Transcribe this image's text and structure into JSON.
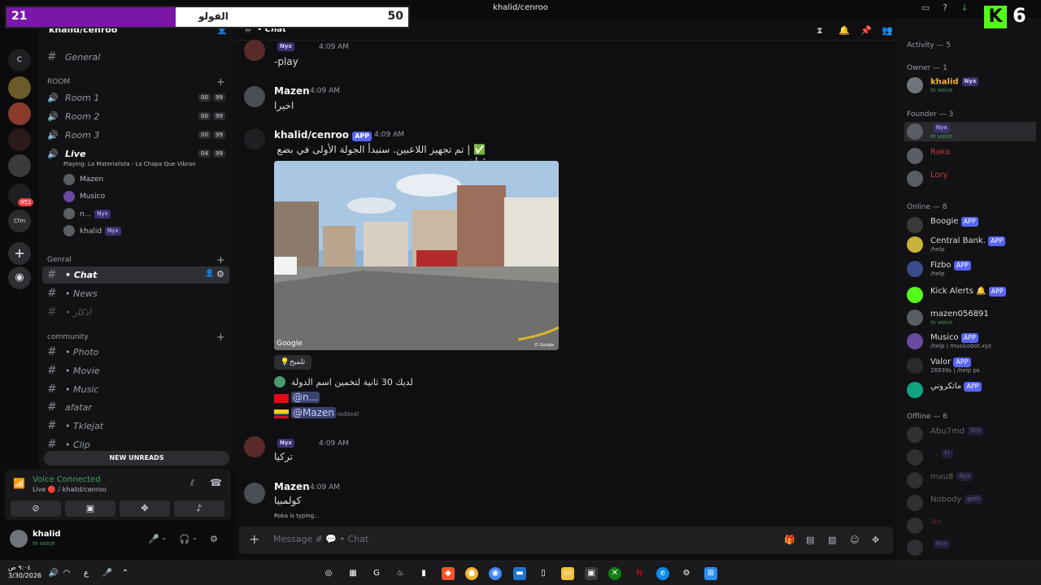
{
  "window": {
    "title": "khalid/cenroo"
  },
  "overlay": {
    "left_score": "21",
    "center_text": "الفولو",
    "right_score": "50",
    "kick_count": "6",
    "kick_logo": "K"
  },
  "rail": {
    "badge1": "951",
    "label_cfm": "Cfm"
  },
  "sidebar": {
    "server_name": "khalid/cenroo",
    "general": "General",
    "room_category": "ROOM",
    "rooms": [
      {
        "label": "Room 1",
        "a": "00",
        "b": "99"
      },
      {
        "label": "Room 2",
        "a": "00",
        "b": "99"
      },
      {
        "label": "Room 3",
        "a": "00",
        "b": "99"
      }
    ],
    "live": {
      "label": "Live",
      "a": "04",
      "b": "99",
      "activity": "Playing: La Materialista - La Chapa Que Vibran"
    },
    "voice_users": [
      {
        "name": "Mazen",
        "tag": ""
      },
      {
        "name": "Musico",
        "tag": ""
      },
      {
        "name": "n...",
        "tag": "Nyx"
      },
      {
        "name": "khalid",
        "tag": "Nyx"
      }
    ],
    "genral_category": "Genral",
    "genral_channels": [
      "• Chat",
      "• News",
      "• اذكار"
    ],
    "community_category": "community",
    "community_channels": [
      "• Photo",
      "• Movie",
      "• Music",
      "afatar",
      "• Tklejat",
      "• Clip"
    ],
    "new_unreads": "NEW UNREADS"
  },
  "voice": {
    "title": "Voice Connected",
    "sub": "Live 🔴 / khalid/cenroo"
  },
  "user": {
    "name": "khalid",
    "status": "In voice"
  },
  "chat": {
    "channel": "• Chat",
    "messages": [
      {
        "author": "",
        "tag": "Nyx",
        "time": "4:09 AM",
        "text": "-play"
      },
      {
        "author": "Mazen",
        "time": "4:09 AM",
        "text": "اخيرا"
      },
      {
        "author": "khalid/cenroo",
        "app": "APP",
        "time": "4:09 AM",
        "text": "✅ | تم تجهيز اللاعبين. سنبدأ الجولة الأولى في بضع ثوانٍ..."
      },
      {
        "author": "",
        "tag": "Nyx",
        "time": "4:09 AM",
        "text": "تركيا"
      },
      {
        "author": "Mazen",
        "time": "4:09 AM",
        "text": "كولمبيا"
      }
    ],
    "image_brand": "Google",
    "image_copyright": "© Google",
    "hint_button": "تلميح",
    "countdown": "لديك 30 ثانية لتخمين اسم الدولة",
    "mention1": "@n...",
    "mention2": "@Mazen",
    "edited": "(edited)",
    "typing": "Roka is typing...",
    "composer_placeholder": "Message # 💬 • Chat"
  },
  "members": {
    "activity_label": "Activity — 5",
    "owner_label": "Owner — 1",
    "owner": {
      "name": "khalid",
      "tag": "Nyx",
      "sub": "In voice"
    },
    "founder_label": "Founder — 3",
    "founders": [
      {
        "name": "",
        "tag": "Nyx",
        "sub": "In voice"
      },
      {
        "name": "Roka",
        "tag": "",
        "sub": ""
      },
      {
        "name": "Lory",
        "tag": "",
        "sub": ""
      }
    ],
    "online_label": "Online — 8",
    "online": [
      {
        "name": "Boogie",
        "app": "APP",
        "sub": ""
      },
      {
        "name": "Central Bank.",
        "app": "APP",
        "sub": "/help"
      },
      {
        "name": "Fizbo",
        "app": "APP",
        "sub": "/help"
      },
      {
        "name": "Kick Alerts 🔔",
        "app": "APP",
        "sub": ""
      },
      {
        "name": "mazen056891",
        "app": "",
        "sub": "In voice"
      },
      {
        "name": "Musico",
        "app": "APP",
        "sub": "/help | musicobot.xyz"
      },
      {
        "name": "Valor",
        "app": "APP",
        "sub": "26939s | /help ps"
      },
      {
        "name": "ماتكروني",
        "app": "APP",
        "sub": ""
      }
    ],
    "offline_label": "Offline — 6",
    "offline": [
      {
        "name": "Abu7md",
        "tag": "505"
      },
      {
        "name": "…",
        "tag": "٣١"
      },
      {
        "name": "mxu8",
        "tag": "Nyx"
      },
      {
        "name": "Nobody",
        "tag": "goth"
      },
      {
        "name": "No",
        "tag": ""
      },
      {
        "name": "",
        "tag": "Nyx"
      }
    ]
  },
  "taskbar": {
    "time": "٩:٠٤ ص",
    "date": "3/30/2026"
  }
}
